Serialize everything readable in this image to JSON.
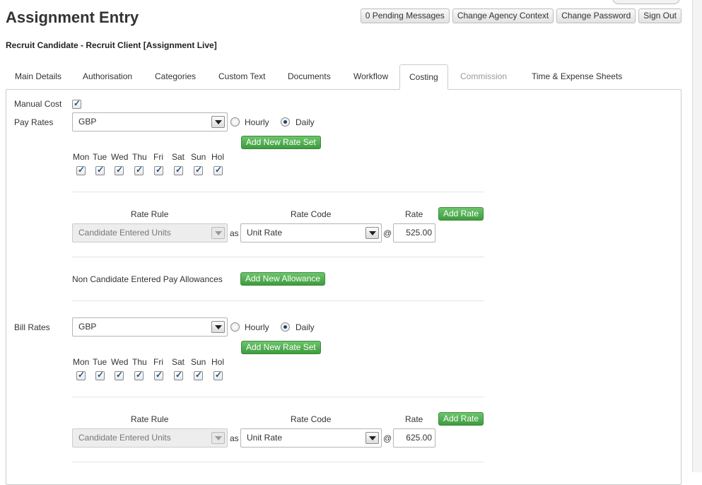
{
  "header": {
    "title": "Assignment Entry",
    "subtitle": "Recruit Candidate - Recruit Client [Assignment Live]",
    "buttons": [
      "0 Pending Messages",
      "Change Agency Context",
      "Change Password",
      "Sign Out"
    ]
  },
  "tabs": [
    {
      "label": "Main Details",
      "state": "normal"
    },
    {
      "label": "Authorisation",
      "state": "normal"
    },
    {
      "label": "Categories",
      "state": "normal"
    },
    {
      "label": "Custom Text",
      "state": "normal"
    },
    {
      "label": "Documents",
      "state": "normal"
    },
    {
      "label": "Workflow",
      "state": "normal"
    },
    {
      "label": "Costing",
      "state": "active"
    },
    {
      "label": "Commission",
      "state": "disabled"
    },
    {
      "label": "Time & Expense Sheets",
      "state": "normal"
    }
  ],
  "costing": {
    "manual_cost_label": "Manual Cost",
    "manual_cost_checked": true,
    "days": [
      "Mon",
      "Tue",
      "Wed",
      "Thu",
      "Fri",
      "Sat",
      "Sun",
      "Hol"
    ],
    "hourly_label": "Hourly",
    "daily_label": "Daily",
    "add_rate_set": "Add New Rate Set",
    "col_rate_rule": "Rate Rule",
    "col_rate_code": "Rate Code",
    "col_rate": "Rate",
    "add_rate": "Add Rate",
    "as_label": "as",
    "at_label": "@",
    "pay": {
      "label": "Pay Rates",
      "currency": "GBP",
      "selected_unit": "Daily",
      "rate_rule": "Candidate Entered Units",
      "rate_code": "Unit Rate",
      "rate": "525.00"
    },
    "allowances_label": "Non Candidate Entered Pay Allowances",
    "add_allowance": "Add New Allowance",
    "bill": {
      "label": "Bill Rates",
      "currency": "GBP",
      "selected_unit": "Daily",
      "rate_rule": "Candidate Entered Units",
      "rate_code": "Unit Rate",
      "rate": "625.00"
    }
  },
  "colors": {
    "green_button": "#4caf50",
    "tab_border": "#cccccc",
    "disabled_text": "#999999"
  }
}
